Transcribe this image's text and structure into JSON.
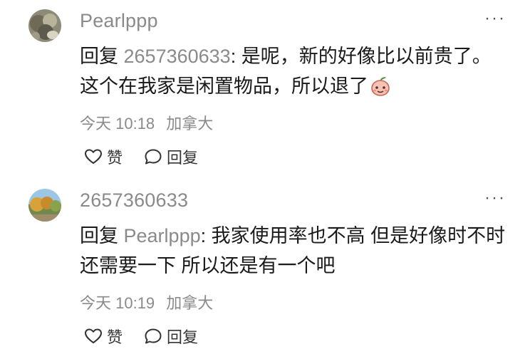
{
  "comments": [
    {
      "username": "Pearlppp",
      "reply_word": "回复",
      "reply_to": "2657360633",
      "text": ": 是呢，新的好像比以前贵了。这个在我家是闲置物品，所以退了",
      "emoji": "peach-emoji",
      "time": "今天 10:18",
      "location": "加拿大",
      "like_label": "赞",
      "reply_label": "回复",
      "more_label": "···"
    },
    {
      "username": "2657360633",
      "reply_word": "回复",
      "reply_to": "Pearlppp",
      "text": ": 我家使用率也不高 但是好像时不时还需要一下 所以还是有一个吧",
      "time": "今天 10:19",
      "location": "加拿大",
      "like_label": "赞",
      "reply_label": "回复",
      "more_label": "···"
    }
  ]
}
